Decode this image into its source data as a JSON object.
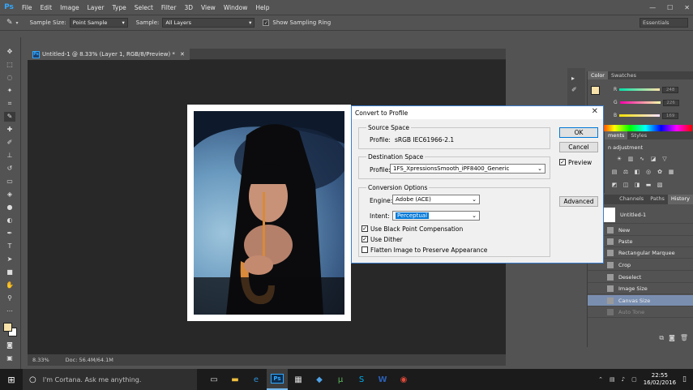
{
  "app": {
    "logo": "Ps"
  },
  "menu": [
    "File",
    "Edit",
    "Image",
    "Layer",
    "Type",
    "Select",
    "Filter",
    "3D",
    "View",
    "Window",
    "Help"
  ],
  "window_controls": {
    "minimize": "—",
    "maximize": "☐",
    "close": "✕"
  },
  "options_bar": {
    "sample_size_label": "Sample Size:",
    "sample_size_value": "Point Sample",
    "sample_label": "Sample:",
    "sample_value": "All Layers",
    "show_ring_label": "Show Sampling Ring",
    "show_ring_checked": true,
    "workspace": "Essentials"
  },
  "document": {
    "tab_title": "Untitled-1 @ 8.33% (Layer 1, RGB/8/Preview) *",
    "zoom": "8.33%",
    "doc_info": "Doc: 56.4M/64.1M"
  },
  "panels": {
    "color_tab": "Color",
    "swatches_tab": "Swatches",
    "r_label": "R",
    "g_label": "G",
    "b_label": "B",
    "r_value": "248",
    "g_value": "226",
    "b_value": "169",
    "adjustments_tab": "ments",
    "styles_tab": "Styles",
    "adjust_title": "n adjustment",
    "channels_tab": "Channels",
    "paths_tab": "Paths",
    "history_tab": "History",
    "history_snapshot": "Untitled-1",
    "history_items": [
      "New",
      "Paste",
      "Rectangular Marquee",
      "Crop",
      "Deselect",
      "Image Size",
      "Canvas Size",
      "Auto Tone"
    ],
    "history_selected": 6,
    "history_dimmed": 7
  },
  "dialog": {
    "title": "Convert to Profile",
    "source_title": "Source Space",
    "source_profile_label": "Profile:",
    "source_profile_value": "sRGB IEC61966-2.1",
    "dest_title": "Destination Space",
    "dest_profile_label": "Profile:",
    "dest_profile_value": "1FS_XpressionsSmooth_iPF8400_Generic",
    "conv_title": "Conversion Options",
    "engine_label": "Engine:",
    "engine_value": "Adobe (ACE)",
    "intent_label": "Intent:",
    "intent_value": "Perceptual",
    "bpc_label": "Use Black Point Compensation",
    "bpc_checked": true,
    "dither_label": "Use Dither",
    "dither_checked": true,
    "flatten_label": "Flatten Image to Preserve Appearance",
    "flatten_checked": false,
    "ok": "OK",
    "cancel": "Cancel",
    "preview_label": "Preview",
    "preview_checked": true,
    "advanced": "Advanced"
  },
  "taskbar": {
    "cortana": "I'm Cortana. Ask me anything.",
    "time": "22:55",
    "date": "16/02/2016"
  },
  "colors": {
    "foreground": "#f8e2a9",
    "background": "#ffffff",
    "accent": "#0078d7"
  }
}
